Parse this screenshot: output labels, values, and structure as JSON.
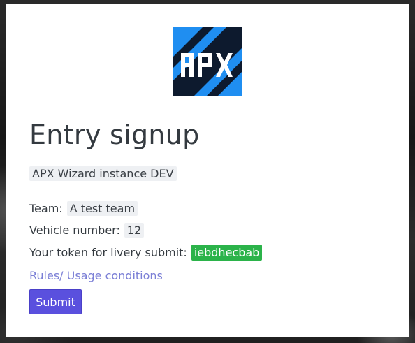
{
  "page": {
    "title": "Entry signup",
    "instance_label": "APX Wizard instance DEV"
  },
  "logo": {
    "text": "APX",
    "colors": {
      "blue": "#1f8ef1",
      "dark": "#0d1a2e"
    }
  },
  "fields": {
    "team_label": "Team:",
    "team_value": "A test team",
    "vehicle_label": "Vehicle number:",
    "vehicle_value": "12",
    "token_label": "Your token for livery submit:",
    "token_value": "iebdhecbab"
  },
  "links": {
    "rules": "Rules/ Usage conditions"
  },
  "actions": {
    "submit_label": "Submit"
  },
  "colors": {
    "token_badge": "#2bb34a",
    "link": "#7b7fd6",
    "submit_button": "#5a50de"
  }
}
